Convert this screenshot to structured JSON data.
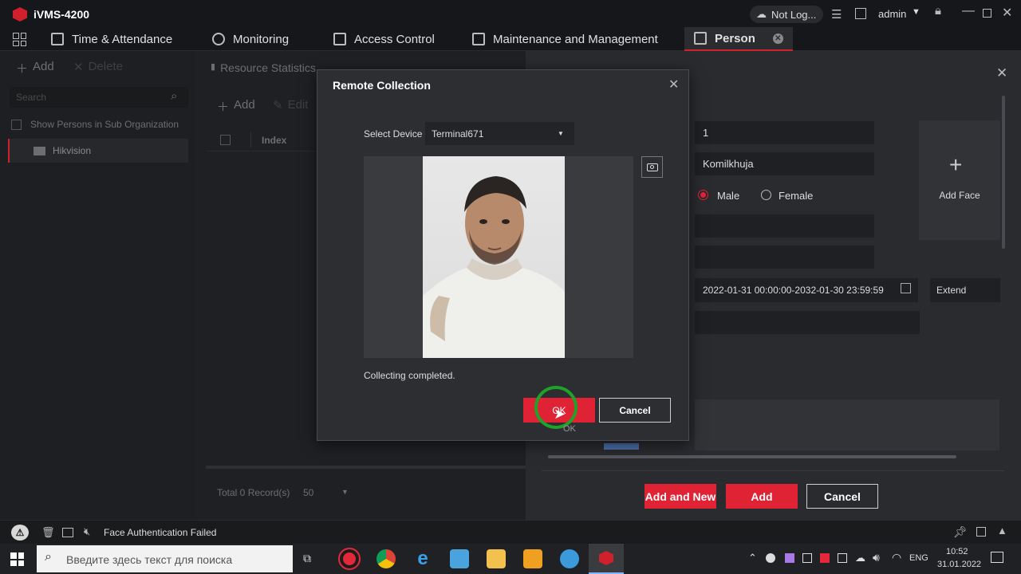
{
  "app": {
    "title": "iVMS-4200",
    "cloud_status": "Not Log...",
    "user": "admin"
  },
  "menu": {
    "time_attendance": "Time & Attendance",
    "monitoring": "Monitoring",
    "access_control": "Access Control",
    "maintenance": "Maintenance and Management",
    "person": "Person"
  },
  "left": {
    "add": "Add",
    "delete": "Delete",
    "search_placeholder": "Search",
    "show_sub_org": "Show Persons in Sub Organization",
    "org": "Hikvision"
  },
  "mid": {
    "resource_stats": "Resource Statistics",
    "add": "Add",
    "edit": "Edit",
    "col_index": "Index",
    "total": "Total 0 Record(s)",
    "page_size": "50"
  },
  "form": {
    "id_value": "1",
    "name_value": "Komilkhuja",
    "gender_male": "Male",
    "gender_female": "Female",
    "validity": "2022-01-31 00:00:00-2032-01-30 23:59:59",
    "extend": "Extend",
    "add_face": "Add Face",
    "btn_add_new": "Add and New",
    "btn_add": "Add",
    "btn_cancel": "Cancel"
  },
  "dialog": {
    "title": "Remote Collection",
    "select_device_label": "Select Device",
    "device": "Terminal671",
    "status": "Collecting completed.",
    "ok": "OK",
    "cancel": "Cancel",
    "tooltip": "OK"
  },
  "statusbar": {
    "message": "Face Authentication Failed"
  },
  "taskbar": {
    "search_placeholder": "Введите здесь текст для поиска",
    "lang": "ENG",
    "time": "10:52",
    "date": "31.01.2022"
  },
  "colors": {
    "accent": "#e02334",
    "bg": "#1b1c1e",
    "panel": "#2a2b2f"
  }
}
